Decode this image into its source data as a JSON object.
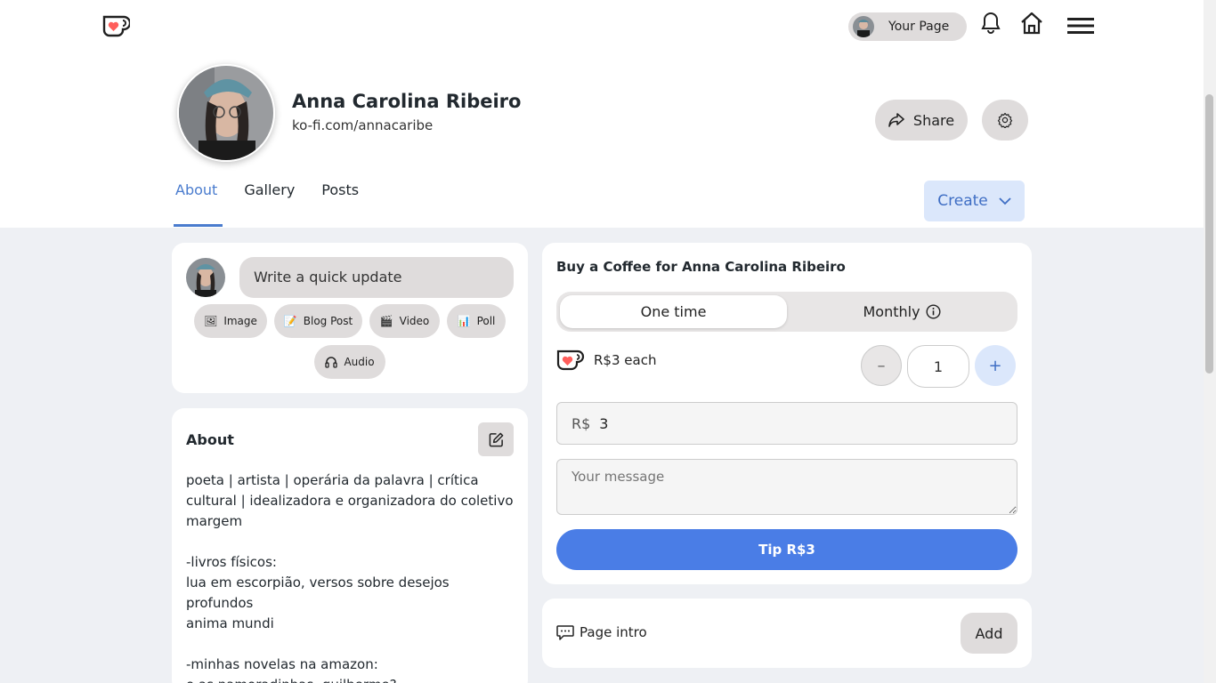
{
  "nav": {
    "your_page_label": "Your Page"
  },
  "profile": {
    "name": "Anna Carolina Ribeiro",
    "url": "ko-fi.com/annacaribe",
    "share_label": "Share"
  },
  "tabs": [
    {
      "label": "About",
      "active": true
    },
    {
      "label": "Gallery",
      "active": false
    },
    {
      "label": "Posts",
      "active": false
    }
  ],
  "create_label": "Create",
  "quick_update": {
    "placeholder": "Write a quick update",
    "chips": [
      {
        "label": "Image",
        "icon": "image-icon"
      },
      {
        "label": "Blog Post",
        "icon": "blog-post-icon"
      },
      {
        "label": "Video",
        "icon": "video-icon"
      },
      {
        "label": "Poll",
        "icon": "poll-icon"
      },
      {
        "label": "Audio",
        "icon": "headphones-icon"
      }
    ]
  },
  "about": {
    "title": "About",
    "body": "poeta | artista | operária da palavra | crítica cultural | idealizadora e organizadora do coletivo margem\n\n-livros físicos:\nlua em escorpião, versos sobre desejos profundos\nanima mundi\n\n-minhas novelas na amazon:\no as namoradinhas, guilherme?"
  },
  "coffee": {
    "title": "Buy a Coffee for Anna Carolina Ribeiro",
    "one_time_label": "One time",
    "monthly_label": "Monthly",
    "price_each": "R$3 each",
    "minus_label": "–",
    "quantity": "1",
    "plus_label": "+",
    "currency": "R$",
    "amount": "3",
    "message_placeholder": "Your message",
    "tip_label": "Tip R$3"
  },
  "page_intro": {
    "label": "Page intro",
    "add_label": "Add"
  },
  "colors": {
    "accent": "#4a7de6",
    "tab_active": "#4a7cce",
    "kofi_red": "#ff5e5b",
    "chip_bg": "#dfdcdc",
    "page_bg": "#eef0f4"
  }
}
